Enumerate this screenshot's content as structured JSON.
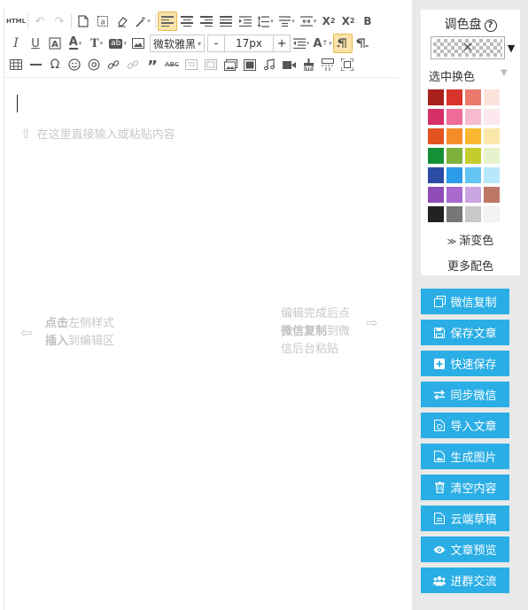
{
  "toolbar": {
    "html_label": "HTML",
    "font_name": "微软雅黑",
    "font_size": "17px",
    "decrease_label": "-",
    "increase_label": "+"
  },
  "editor": {
    "hint_top": "在这里直接输入或粘贴内容",
    "hint_left_line1_bold": "点击",
    "hint_left_line1_rest": "左侧样式",
    "hint_left_line2_bold": "插入",
    "hint_left_line2_rest": "到编辑区",
    "hint_right_line1": "编辑完成后点",
    "hint_right_line2_bold": "微信复制",
    "hint_right_line2_rest": "到微",
    "hint_right_line3": "信后台粘贴"
  },
  "palette": {
    "title": "调色盘",
    "help_glyph": "?",
    "mode_label": "选中换色",
    "gradient_label": "渐变色",
    "more_colors_label": "更多配色",
    "colors": [
      "#a9201b",
      "#d9342b",
      "#ec7a6c",
      "#fbe3dc",
      "#d62e68",
      "#ee6c95",
      "#f6bccd",
      "#fde8ee",
      "#e3531f",
      "#f68c29",
      "#f9b82f",
      "#fbe8a8",
      "#159038",
      "#7fb23c",
      "#c5cc2d",
      "#e6f2cb",
      "#2c4ba4",
      "#2c9bea",
      "#62c5f3",
      "#b8e6fa",
      "#8f4bb8",
      "#a96ad0",
      "#caa6e1",
      "#bd7766",
      "#222222",
      "#777777",
      "#c8c8c8",
      "#f4f4f4"
    ]
  },
  "actions": [
    {
      "label": "微信复制",
      "icon": "copy-icon"
    },
    {
      "label": "保存文章",
      "icon": "save-icon"
    },
    {
      "label": "快速保存",
      "icon": "plus-square-icon"
    },
    {
      "label": "同步微信",
      "icon": "sync-icon"
    },
    {
      "label": "导入文章",
      "icon": "import-icon"
    },
    {
      "label": "生成图片",
      "icon": "image-icon"
    },
    {
      "label": "清空内容",
      "icon": "trash-icon"
    },
    {
      "label": "云端草稿",
      "icon": "draft-icon"
    },
    {
      "label": "文章预览",
      "icon": "eye-icon"
    },
    {
      "label": "进群交流",
      "icon": "group-icon"
    }
  ]
}
